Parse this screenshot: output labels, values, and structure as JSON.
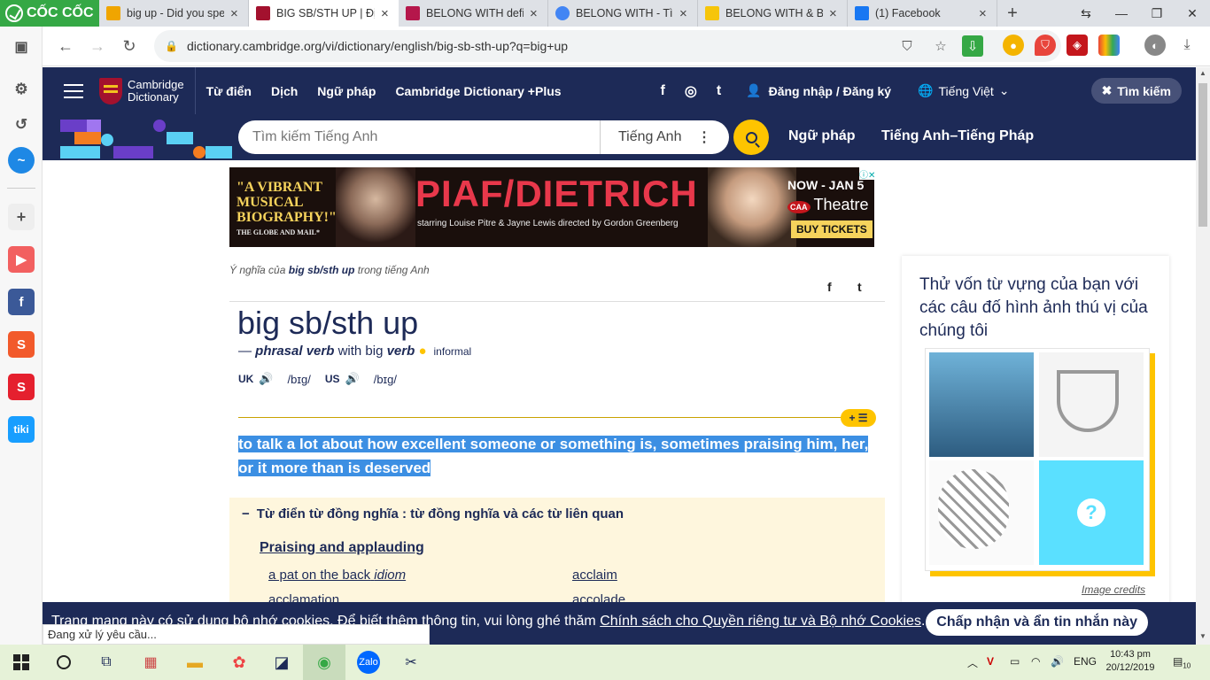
{
  "browser": {
    "brand": "CỐC CỐC",
    "tabs": [
      {
        "title": "big up - Did you spell",
        "favicon_color": "#f0a500"
      },
      {
        "title": "BIG SB/STH UP | Định",
        "favicon_color": "#a3112e"
      },
      {
        "title": "BELONG WITH definiti",
        "favicon_color": "#b5174b"
      },
      {
        "title": "BELONG WITH - Tìm",
        "favicon_color": "#4285f4"
      },
      {
        "title": "BELONG WITH & BEL",
        "favicon_color": "#f6c50a"
      },
      {
        "title": "(1) Facebook",
        "favicon_color": "#1877f2"
      }
    ],
    "url": "dictionary.cambridge.org/vi/dictionary/english/big-sb-sth-up?q=big+up",
    "status_text": "Đang xử lý yêu cầu..."
  },
  "site": {
    "logo_line1": "Cambridge",
    "logo_line2": "Dictionary",
    "nav": [
      "Từ điển",
      "Dịch",
      "Ngữ pháp",
      "Cambridge Dictionary +Plus"
    ],
    "social": [
      "f",
      "◎",
      "t"
    ],
    "login": "Đăng nhập / Đăng ký",
    "language": "Tiếng Việt",
    "search_toggle": "Tìm kiếm",
    "search_placeholder": "Tìm kiếm Tiếng Anh",
    "search_dict": "Tiếng Anh",
    "links": [
      "Ngữ pháp",
      "Tiếng Anh–Tiếng Pháp"
    ]
  },
  "ad": {
    "quote": "\"A VIBRANT MUSICAL BIOGRAPHY!\"",
    "source": "THE GLOBE AND MAIL*",
    "title": "PIAF/DIETRICH",
    "starring": "starring Louise Pitre & Jayne Lewis   directed by Gordon Greenberg",
    "dates": "NOW - JAN 5",
    "venue": "Theatre",
    "venue_badge": "CAA",
    "cta": "BUY TICKETS"
  },
  "entry": {
    "crumb_prefix": "Ý nghĩa của",
    "crumb_word": "big sb/sth up",
    "crumb_suffix": "trong tiếng Anh",
    "headword": "big sb/sth up",
    "pos_dash": "—",
    "pos": "phrasal verb",
    "pos_with": "with big",
    "pos_verb": "verb",
    "register": "informal",
    "uk_label": "UK",
    "uk_ipa": "/bɪɡ/",
    "us_label": "US",
    "us_ipa": "/bɪɡ/",
    "plus_label": "+ ☰",
    "definition": "to talk a lot about how excellent someone or something is, sometimes praising him, her, or it more than is deserved"
  },
  "thesaurus": {
    "heading": "Từ điển từ đồng nghĩa : từ đồng nghĩa và các từ liên quan",
    "category": "Praising and applauding",
    "words": [
      "a pat on the back",
      "acclaim",
      "acclamation",
      "accolade"
    ],
    "idiom_label": "idiom"
  },
  "quiz": {
    "prompt": "Thử vốn từ vựng của bạn với các câu đố hình ảnh thú vị của chúng tôi",
    "credits": "Image credits",
    "unknown": "?"
  },
  "cookie": {
    "text": "Trang mạng này có sử dụng bộ nhớ cookies. Để biết thêm thông tin, vui lòng ghé thăm",
    "link": "Chính sách cho Quyền riêng tư và Bộ nhớ Cookies",
    "period": ".",
    "accept": "Chấp nhận và ẩn tin nhắn này"
  },
  "taskbar": {
    "lang": "ENG",
    "time": "10:43 pm",
    "date": "20/12/2019",
    "notif": "10"
  },
  "colors": {
    "site_navy": "#1d2a57",
    "accent_yellow": "#fec400",
    "selection": "#3c8fe3",
    "thesaurus_bg": "#fef6dd",
    "browser_green": "#35a845"
  }
}
